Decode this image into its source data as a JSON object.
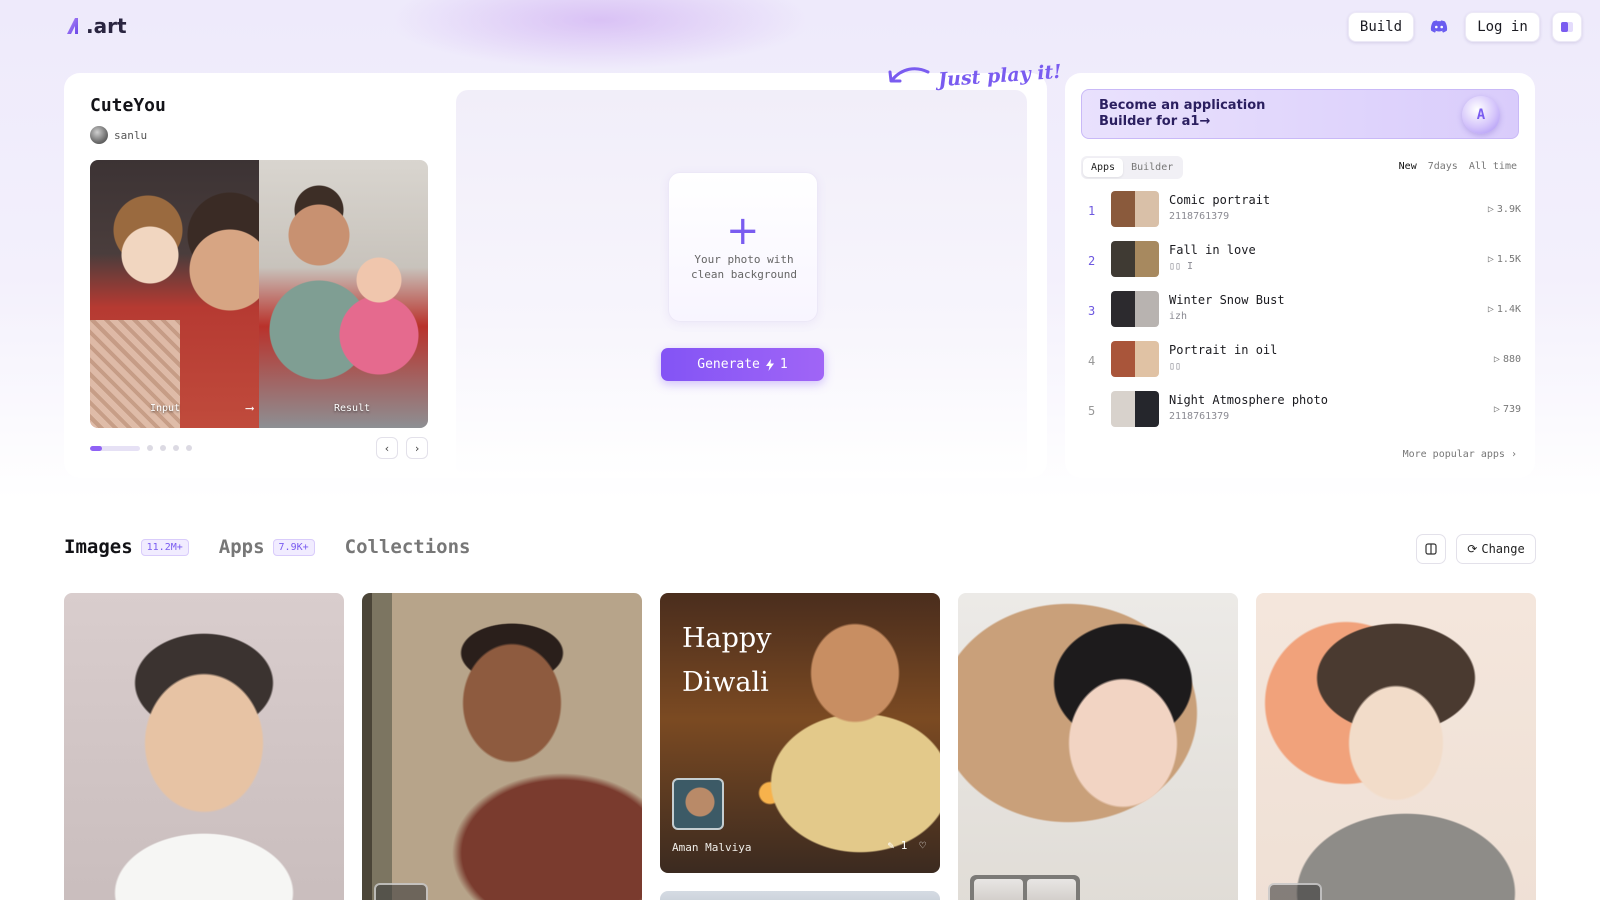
{
  "header": {
    "logo_text": ".art",
    "build_label": "Build",
    "login_label": "Log in"
  },
  "hero": {
    "app_title": "CuteYou",
    "author": "sanlu",
    "input_label": "Input",
    "result_label": "Result",
    "arrow": "⟶",
    "upload_text": "Your photo with\nclean background",
    "generate_label": "Generate",
    "generate_cost": "1",
    "just_play": "Just play it!"
  },
  "ranking": {
    "banner_text": "Become an application\nBuilder for a1→",
    "tabs": [
      "Apps",
      "Builder"
    ],
    "active_tab": "Apps",
    "filters": [
      "New",
      "7days",
      "All time"
    ],
    "active_filter": "New",
    "items": [
      {
        "rank": "1",
        "name": "Comic portrait",
        "author": "2118761379",
        "count": "3.9K",
        "thumb": [
          "#8a5a3c",
          "#d9c0a8"
        ]
      },
      {
        "rank": "2",
        "name": "Fall in love",
        "author": "▯▯ I",
        "count": "1.5K",
        "thumb": [
          "#3f3a33",
          "#a7895f"
        ]
      },
      {
        "rank": "3",
        "name": "Winter Snow Bust",
        "author": "izh",
        "count": "1.4K",
        "thumb": [
          "#2c2a2e",
          "#b8b3b0"
        ]
      },
      {
        "rank": "4",
        "name": "Portrait in oil",
        "author": "▯▯",
        "count": "880",
        "thumb": [
          "#a9553a",
          "#e0c2a4"
        ]
      },
      {
        "rank": "5",
        "name": "Night Atmosphere photo",
        "author": "2118761379",
        "count": "739",
        "thumb": [
          "#d8d2cc",
          "#25262c"
        ]
      }
    ],
    "more_label": "More popular apps"
  },
  "section": {
    "tabs": [
      {
        "label": "Images",
        "badge": "11.2M+"
      },
      {
        "label": "Apps",
        "badge": "7.9K+"
      },
      {
        "label": "Collections",
        "badge": ""
      }
    ],
    "change_label": "Change"
  },
  "gallery": {
    "diwali_text": "Happy\nDiwali",
    "card_user": "Aman Malviya",
    "remix_count": "1"
  },
  "colors": {
    "accent": "#8354f5",
    "accent_light": "#f1ecff"
  }
}
